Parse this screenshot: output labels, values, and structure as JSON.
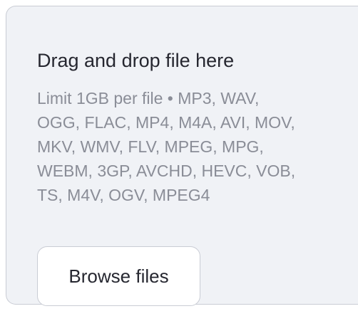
{
  "uploader": {
    "title": "Drag and drop file here",
    "limit_lines": [
      "Limit 1GB per file • MP3, WAV,",
      "OGG, FLAC, MP4, M4A, AVI, MOV,",
      "MKV, WMV, FLV, MPEG, MPG,",
      "WEBM, 3GP, AVCHD, HEVC, VOB,",
      "TS, M4V, OGV, MPEG4"
    ],
    "browse_label": "Browse files"
  },
  "colors": {
    "background": "#f0f2f6",
    "border": "#c9ccd4",
    "title_text": "#262730",
    "hint_text": "#8a8d97",
    "button_background": "#ffffff"
  }
}
